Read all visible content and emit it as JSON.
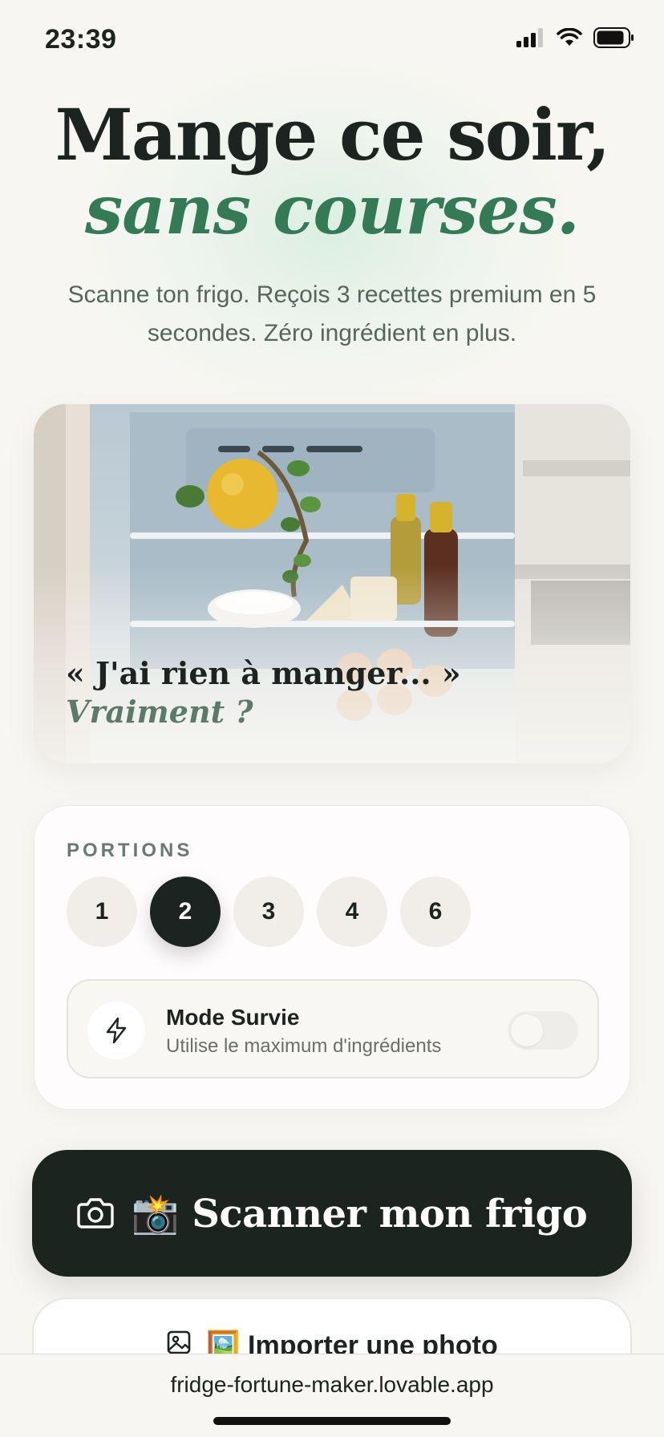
{
  "status_bar": {
    "time": "23:39"
  },
  "hero": {
    "headline": "Mange ce soir,",
    "headline_accent": "sans courses.",
    "subtitle": "Scanne ton frigo. Reçois 3 recettes premium en 5 secondes. Zéro ingrédient en plus."
  },
  "fridge": {
    "quote": "« J'ai rien à manger... »",
    "quote_accent": "Vraiment ?"
  },
  "options": {
    "portions_label": "PORTIONS",
    "portions": [
      "1",
      "2",
      "3",
      "4",
      "6"
    ],
    "selected_portion": "2",
    "mode": {
      "title": "Mode Survie",
      "subtitle": "Utilise le maximum d'ingrédients",
      "enabled": false,
      "icon": "lightning-icon"
    }
  },
  "actions": {
    "scan_label": "📸 Scanner mon frigo",
    "import_label": "🖼️ Importer une photo"
  },
  "browser": {
    "url": "fridge-fortune-maker.lovable.app"
  },
  "colors": {
    "accent_green": "#357a57",
    "dark": "#1c2420",
    "background": "#f7f6f2"
  }
}
